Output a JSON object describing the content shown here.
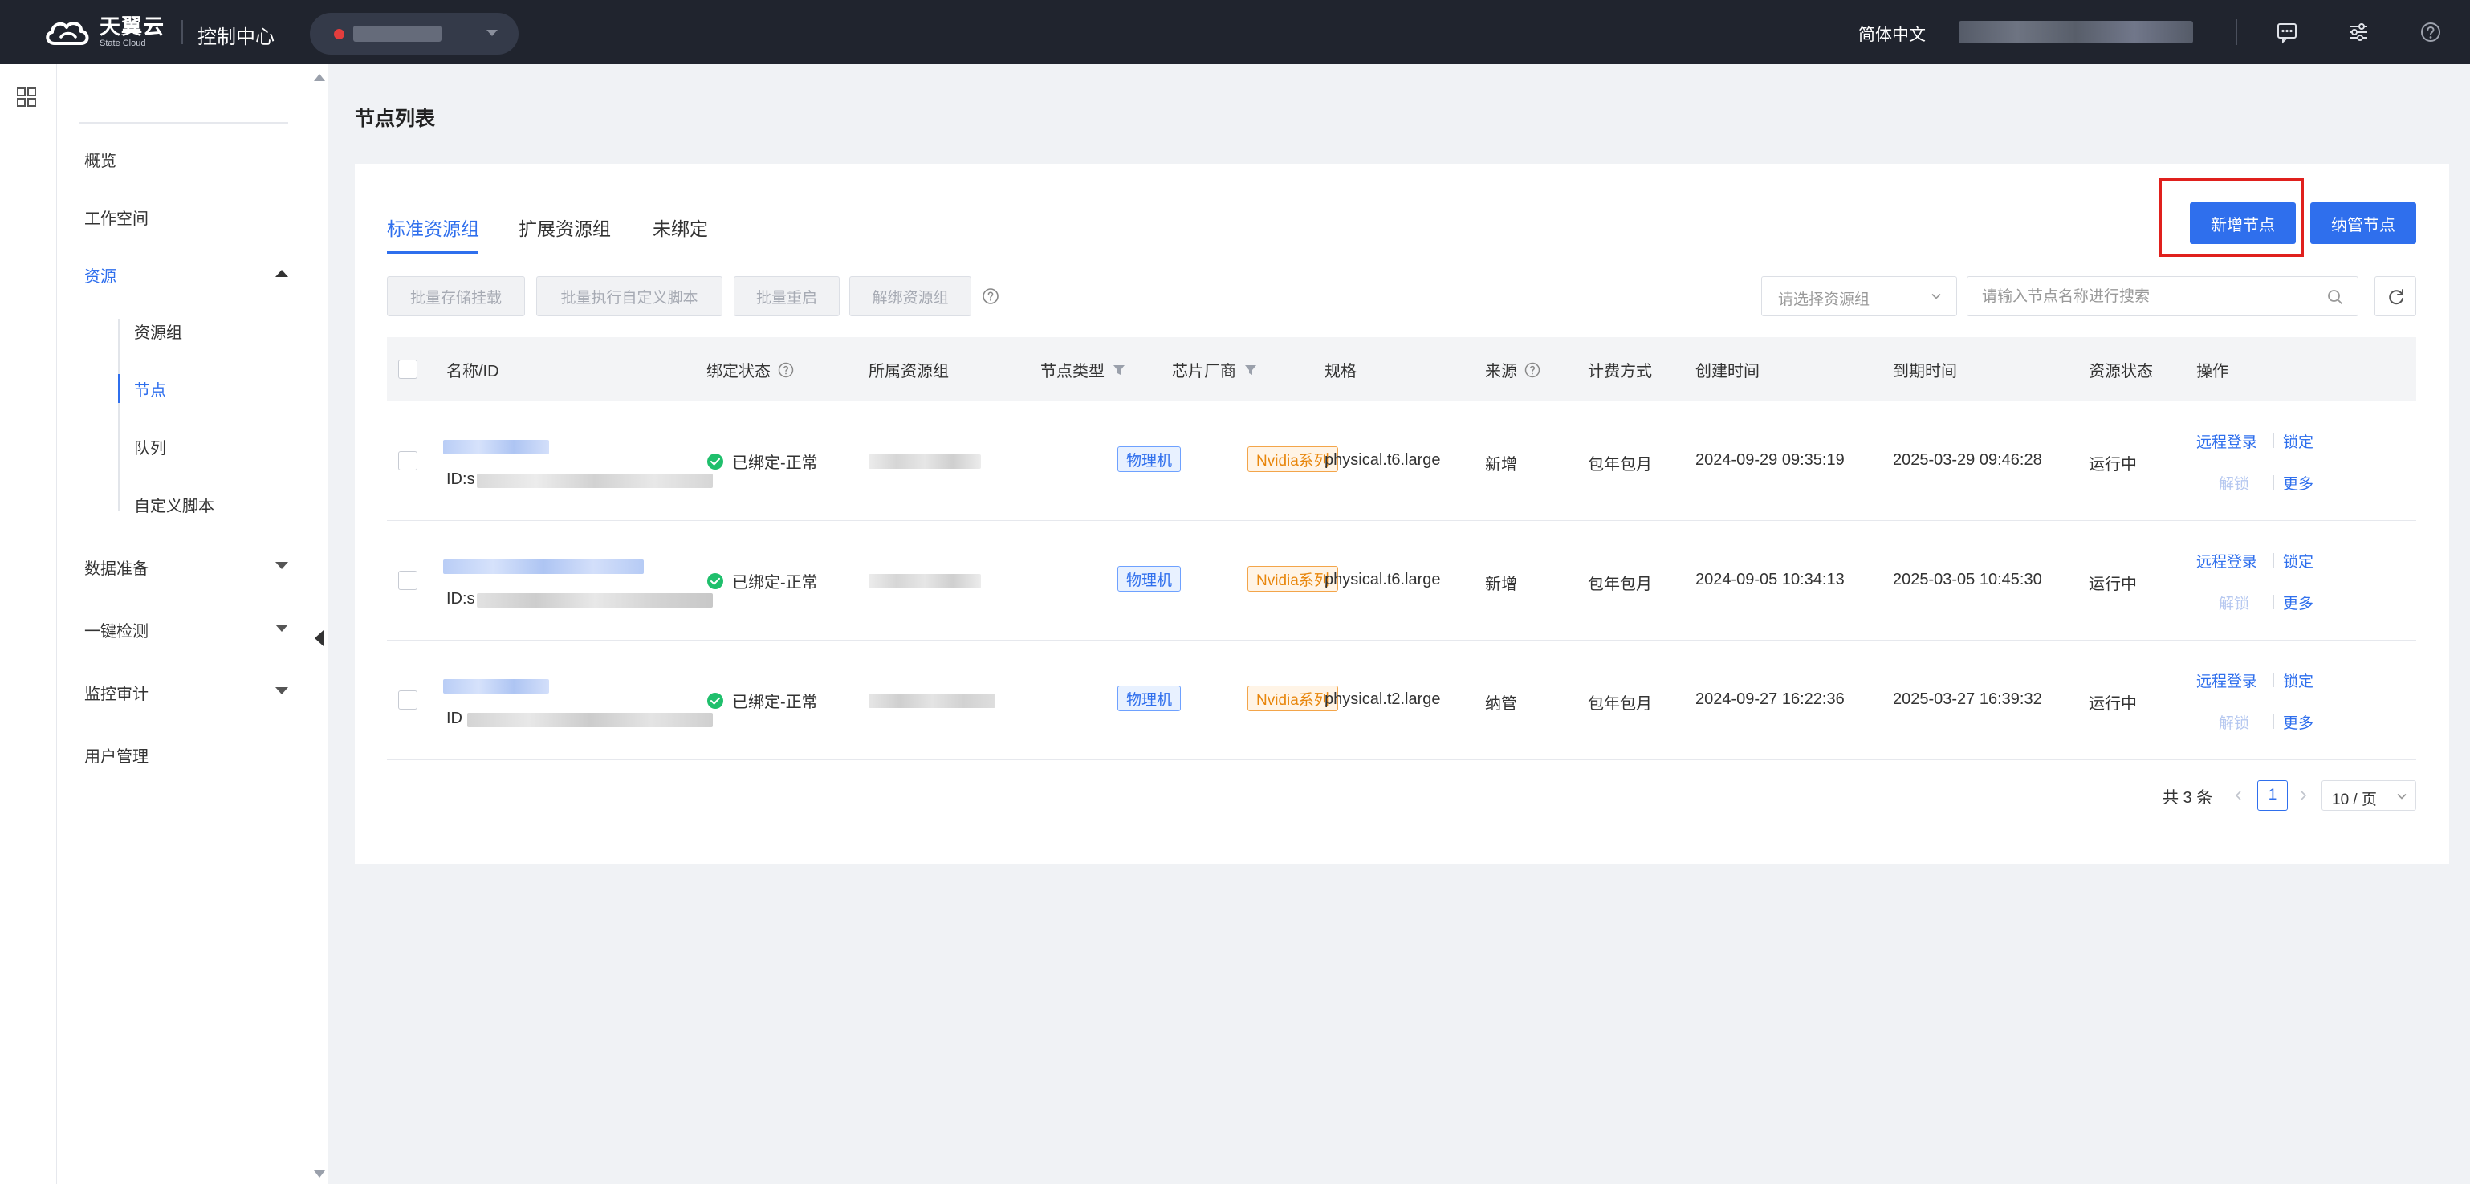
{
  "topbar": {
    "logo_cn": "天翼云",
    "logo_en": "State Cloud",
    "console": "控制中心",
    "language": "简体中文",
    "icons": [
      "message-icon",
      "settings-sliders-icon",
      "help-icon"
    ]
  },
  "sidebar": {
    "items": [
      {
        "label": "概览"
      },
      {
        "label": "工作空间"
      },
      {
        "label": "资源",
        "expanded": true,
        "active": true
      },
      {
        "label": "数据准备"
      },
      {
        "label": "一键检测"
      },
      {
        "label": "监控审计"
      },
      {
        "label": "用户管理"
      }
    ],
    "sub_items": [
      {
        "label": "资源组"
      },
      {
        "label": "节点",
        "active": true
      },
      {
        "label": "队列"
      },
      {
        "label": "自定义脚本"
      }
    ]
  },
  "page": {
    "title": "节点列表"
  },
  "tabs": [
    {
      "label": "标准资源组",
      "active": true
    },
    {
      "label": "扩展资源组"
    },
    {
      "label": "未绑定"
    }
  ],
  "actions": {
    "add_node": "新增节点",
    "manage_node": "纳管节点"
  },
  "batch": {
    "storage_mount": "批量存储挂载",
    "run_script": "批量执行自定义脚本",
    "reboot": "批量重启",
    "unbind": "解绑资源组"
  },
  "filters": {
    "resource_group_placeholder": "请选择资源组",
    "search_placeholder": "请输入节点名称进行搜索"
  },
  "table": {
    "columns": [
      "名称/ID",
      "绑定状态",
      "所属资源组",
      "节点类型",
      "芯片厂商",
      "规格",
      "来源",
      "计费方式",
      "创建时间",
      "到期时间",
      "资源状态",
      "操作"
    ],
    "rows": [
      {
        "id_prefix": "ID:s",
        "bind_status": "已绑定-正常",
        "node_type": "物理机",
        "vendor": "Nvidia系列",
        "spec": "physical.t6.large",
        "source": "新增",
        "billing": "包年包月",
        "created": "2024-09-29 09:35:19",
        "expires": "2025-03-29 09:46:28",
        "state": "运行中"
      },
      {
        "id_prefix": "ID:s",
        "bind_status": "已绑定-正常",
        "node_type": "物理机",
        "vendor": "Nvidia系列",
        "spec": "physical.t6.large",
        "source": "新增",
        "billing": "包年包月",
        "created": "2024-09-05 10:34:13",
        "expires": "2025-03-05 10:45:30",
        "state": "运行中"
      },
      {
        "id_prefix": "ID",
        "bind_status": "已绑定-正常",
        "node_type": "物理机",
        "vendor": "Nvidia系列",
        "spec": "physical.t2.large",
        "source": "纳管",
        "billing": "包年包月",
        "created": "2024-09-27 16:22:36",
        "expires": "2025-03-27 16:39:32",
        "state": "运行中"
      }
    ],
    "ops": {
      "remote_login": "远程登录",
      "lock": "锁定",
      "unlock": "解锁",
      "more": "更多"
    }
  },
  "pagination": {
    "total": "共 3 条",
    "current_page": "1",
    "page_size": "10 / 页"
  },
  "colors": {
    "accent": "#2f6fed",
    "topbar": "#20242e",
    "highlight": "#e0201d",
    "success": "#1fbf6c"
  }
}
